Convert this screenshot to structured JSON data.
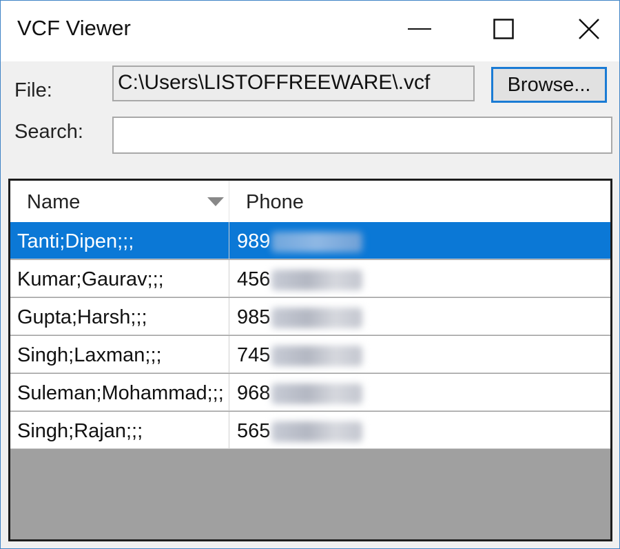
{
  "window": {
    "title": "VCF Viewer"
  },
  "form": {
    "file_label": "File:",
    "file_value": "C:\\Users\\LISTOFFREEWARE\\.vcf",
    "browse_label": "Browse...",
    "search_label": "Search:",
    "search_value": ""
  },
  "table": {
    "columns": [
      "Name",
      "Phone"
    ],
    "sort_column": "Name",
    "rows": [
      {
        "name": "Tanti;Dipen;;;",
        "phone": "989",
        "selected": true
      },
      {
        "name": "Kumar;Gaurav;;;",
        "phone": "456",
        "selected": false
      },
      {
        "name": "Gupta;Harsh;;;",
        "phone": "985",
        "selected": false
      },
      {
        "name": "Singh;Laxman;;;",
        "phone": "745",
        "selected": false
      },
      {
        "name": "Suleman;Mohammad;;;",
        "phone": "968",
        "selected": false
      },
      {
        "name": "Singh;Rajan;;;",
        "phone": "565",
        "selected": false
      }
    ]
  },
  "colors": {
    "selection": "#0b78d6",
    "focus_border": "#1a7bd4",
    "empty_area": "#a0a0a0"
  },
  "icons": [
    "minimize-icon",
    "maximize-icon",
    "close-icon",
    "sort-down-icon"
  ]
}
